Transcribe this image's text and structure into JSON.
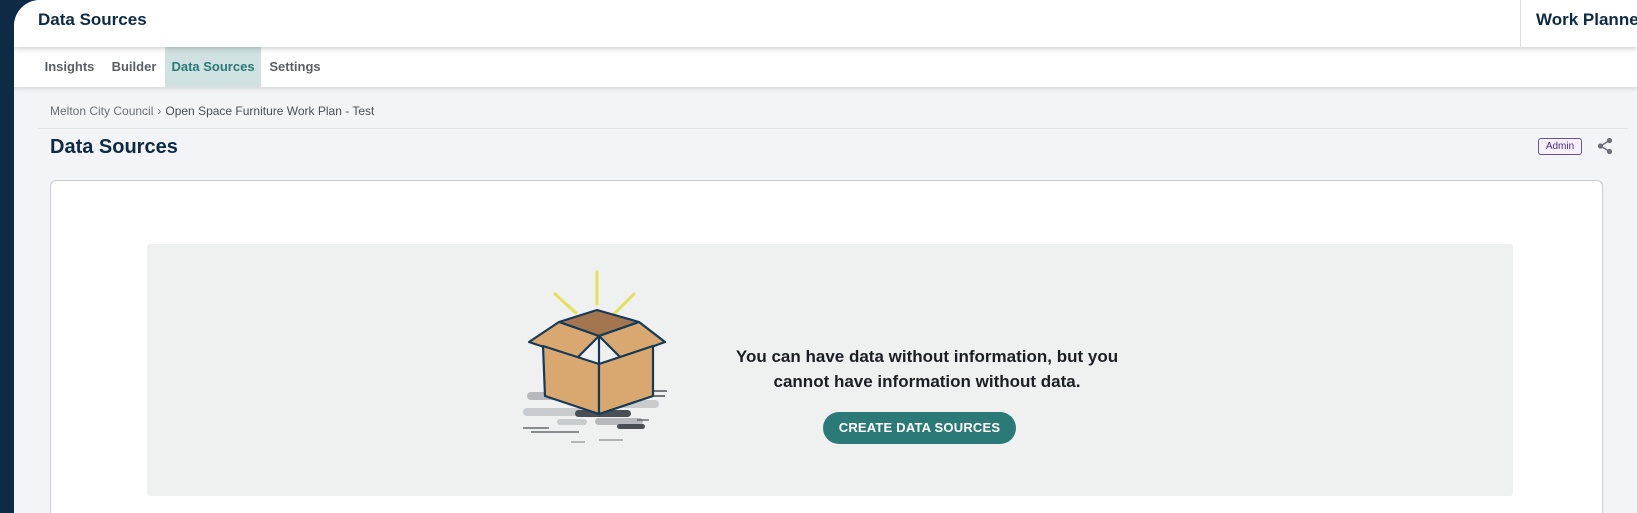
{
  "header": {
    "title": "Data Sources",
    "product": "Work Planner"
  },
  "tabs": [
    {
      "label": "Insights",
      "active": false
    },
    {
      "label": "Builder",
      "active": false
    },
    {
      "label": "Data Sources",
      "active": true
    },
    {
      "label": "Settings",
      "active": false
    }
  ],
  "breadcrumb": {
    "parent": "Melton City Council",
    "separator": "›",
    "current": "Open Space Furniture Work Plan - Test"
  },
  "page": {
    "title": "Data Sources",
    "role_badge": "Admin",
    "share_icon": "share-icon"
  },
  "empty_state": {
    "illustration_icon": "open-box-icon",
    "message": "You can have data without information, but you cannot have information without data.",
    "cta_label": "CREATE DATA SOURCES"
  },
  "colors": {
    "sidebar": "#0d2b45",
    "accent": "#2b7a78",
    "active_tab_bg": "#cfe2e1",
    "badge": "#6a4fa0"
  }
}
